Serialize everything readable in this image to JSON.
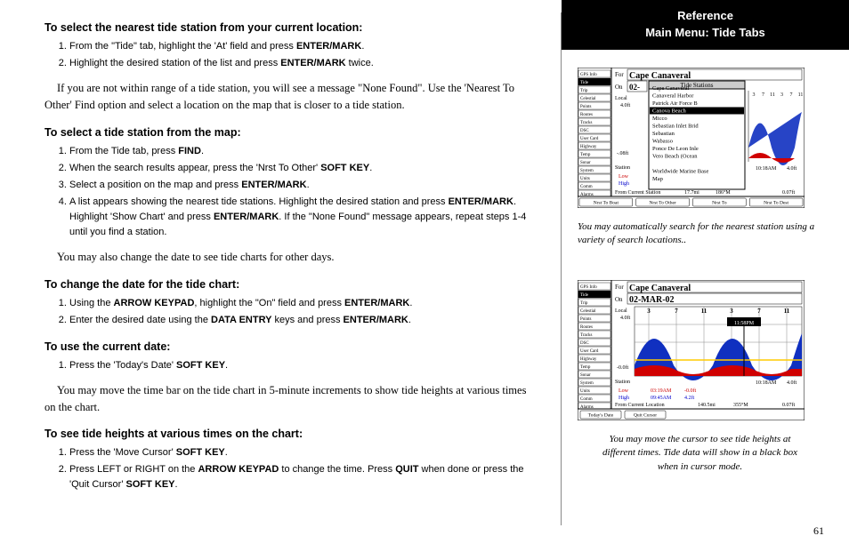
{
  "ref": {
    "line1": "Reference",
    "line2": "Main Menu: Tide Tabs"
  },
  "h1": "To select the nearest tide station from your current location:",
  "s1": {
    "a1": "From the \"Tide\" tab, highlight the 'At' field and press ",
    "a2": "ENTER/MARK",
    "a3": ".",
    "b1": "Highlight the desired station of the list and press ",
    "b2": "ENTER/MARK",
    "b3": " twice."
  },
  "p1a": "If you are not within range of a tide station, you will see a message \"None Found\". Use the 'Nearest To Other' Find option and select a location on the map that is closer to a tide station.",
  "h2": "To select a tide station from the map:",
  "s2": {
    "a1": "From the Tide tab, press ",
    "a2": "FIND",
    "a3": ".",
    "b1": "When the search results appear, press the 'Nrst To Other' ",
    "b2": "SOFT KEY",
    "b3": ".",
    "c1": "Select a position on the map and press ",
    "c2": "ENTER/MARK",
    "c3": ".",
    "d1": "A list appears showing the nearest tide stations. Highlight the desired station and press ",
    "d2": "ENTER/MARK",
    "d3": ". Highlight 'Show Chart' and press ",
    "d4": "ENTER/MARK",
    "d5": ". If the \"None Found\" message appears, repeat steps 1-4 until you find a station."
  },
  "p2": "You may also change the date to see tide charts for other days.",
  "h3": "To change the date for the tide chart:",
  "s3": {
    "a1": "Using the ",
    "a2": "ARROW KEYPAD",
    "a3": ", highlight the \"On\" field and press ",
    "a4": "ENTER/MARK",
    "a5": ".",
    "b1": "Enter the desired date using the ",
    "b2": "DATA ENTRY",
    "b3": " keys and press ",
    "b4": "ENTER/MARK",
    "b5": "."
  },
  "h4": "To use the current date:",
  "s4": {
    "a1": "Press the 'Today's Date' ",
    "a2": "SOFT KEY",
    "a3": "."
  },
  "p3": "You may move the time bar on the tide chart in 5-minute increments to show tide heights at various times on the chart.",
  "h5": "To see tide heights at various times on the chart:",
  "s5": {
    "a1": "Press the 'Move Cursor' ",
    "a2": "SOFT KEY",
    "a3": ".",
    "b1": "Press LEFT or RIGHT on the ",
    "b2": "ARROW KEYPAD",
    "b3": " to change the time. Press ",
    "b4": "QUIT",
    "b5": " when done or press the 'Quit Cursor' ",
    "b6": "SOFT KEY",
    "b7": "."
  },
  "cap1": "You may automatically search for the nearest station using a variety of search locations..",
  "cap2": "You may move the cursor to see tide heights at different times. Tide data will show in a black box when in cursor mode.",
  "pageNum": "61",
  "fig1": {
    "sidebar": [
      "GPS Info",
      "Tide",
      "Trip",
      "Celestial",
      "Points",
      "Routes",
      "Tracks",
      "DSC",
      "User Card",
      "Highway",
      "Temp",
      "Sonar",
      "System",
      "Units",
      "Comm",
      "Alarms"
    ],
    "for": "For",
    "on": "On",
    "date": "02-",
    "listTitle": "Tide Stations",
    "list": [
      "Cape Canaveral",
      "Canaveral Harbor",
      "Patrick Air Force B",
      "Canova Beach",
      "Micco",
      "Sebastian Inlet Brid",
      "Sebastian",
      "Wabasso",
      "Ponce De Leon Inle",
      "Vero Beach (Ocean",
      "",
      "Worldwide Marine Base",
      "Map"
    ],
    "listSel": 3,
    "localTop": "Local",
    "localBot": "4.0ft",
    "leftMid": "-.08ft",
    "stationLbl": "Station",
    "lowLbl": "Low",
    "highLbl": "High",
    "fromLbl": "From Current Station",
    "fromDist": "17.7mi",
    "fromBrg": "186°M",
    "softkeys": [
      "Nrst To Boat",
      "Nrst To Other",
      "Nrst To",
      "Nrst To Dest"
    ],
    "xticks": [
      "3",
      "7",
      "11",
      "3",
      "7",
      "11"
    ],
    "xticksBot": [
      "10:18AM",
      "4.0ft"
    ],
    "rightDist": "0.07ft"
  },
  "fig2": {
    "sidebar": [
      "GPS Info",
      "Tide",
      "Trip",
      "Celestial",
      "Points",
      "Routes",
      "Tracks",
      "DSC",
      "User Card",
      "Highway",
      "Temp",
      "Sonar",
      "System",
      "Units",
      "Comm",
      "Alarms"
    ],
    "for": "For",
    "on": "On",
    "station": "Cape Canaveral",
    "date": "02-MAR-02",
    "localTop": "Local",
    "localBot": "4.0ft",
    "leftMid": "-0.0ft",
    "stationLbl": "Station",
    "lowLbl": "Low",
    "highLbl": "High",
    "lowTime": "03:19AM",
    "lowVal": "-0.0ft",
    "highTime": "09:45AM",
    "highVal": "4.2ft",
    "cursorTime": "11:58PM",
    "fromLbl": "From Current Location",
    "fromDist": "140.5mi",
    "fromBrg": "355°M",
    "rightDist": "0.07ft",
    "softkeys": [
      "Today's Date",
      "Quit Cursor"
    ],
    "xticks": [
      "3",
      "7",
      "11",
      "3",
      "7",
      "11"
    ],
    "xticksBot": [
      "10:18AM",
      "4.0ft"
    ]
  }
}
